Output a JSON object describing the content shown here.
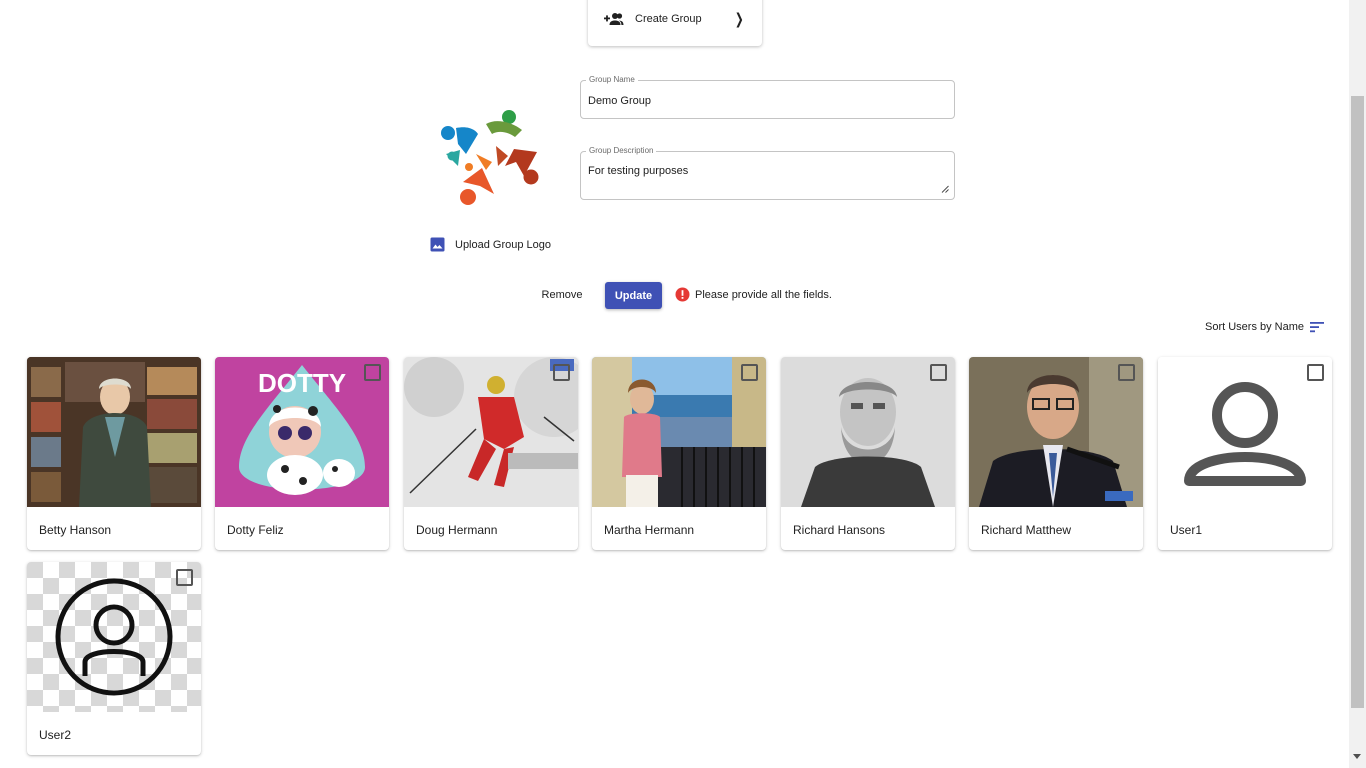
{
  "create_group": {
    "label": "Create Group",
    "icon": "group-add-icon"
  },
  "form": {
    "name_label": "Group Name",
    "name_value": "Demo Group",
    "description_label": "Group Description",
    "description_value": "For testing purposes"
  },
  "upload": {
    "label": "Upload Group Logo",
    "icon": "image-icon"
  },
  "actions": {
    "remove_label": "Remove",
    "update_label": "Update",
    "error_message": "Please provide all the fields."
  },
  "sort": {
    "label": "Sort Users by Name",
    "icon": "sort-icon"
  },
  "users": [
    {
      "name": "Betty Hanson"
    },
    {
      "name": "Dotty Feliz",
      "photo_text": "DOTTY"
    },
    {
      "name": "Doug Hermann"
    },
    {
      "name": "Martha Hermann"
    },
    {
      "name": "Richard Hansons"
    },
    {
      "name": "Richard Matthew"
    },
    {
      "name": "User1"
    },
    {
      "name": "User2"
    }
  ],
  "colors": {
    "accent": "#3f51b5",
    "error": "#e53935"
  }
}
